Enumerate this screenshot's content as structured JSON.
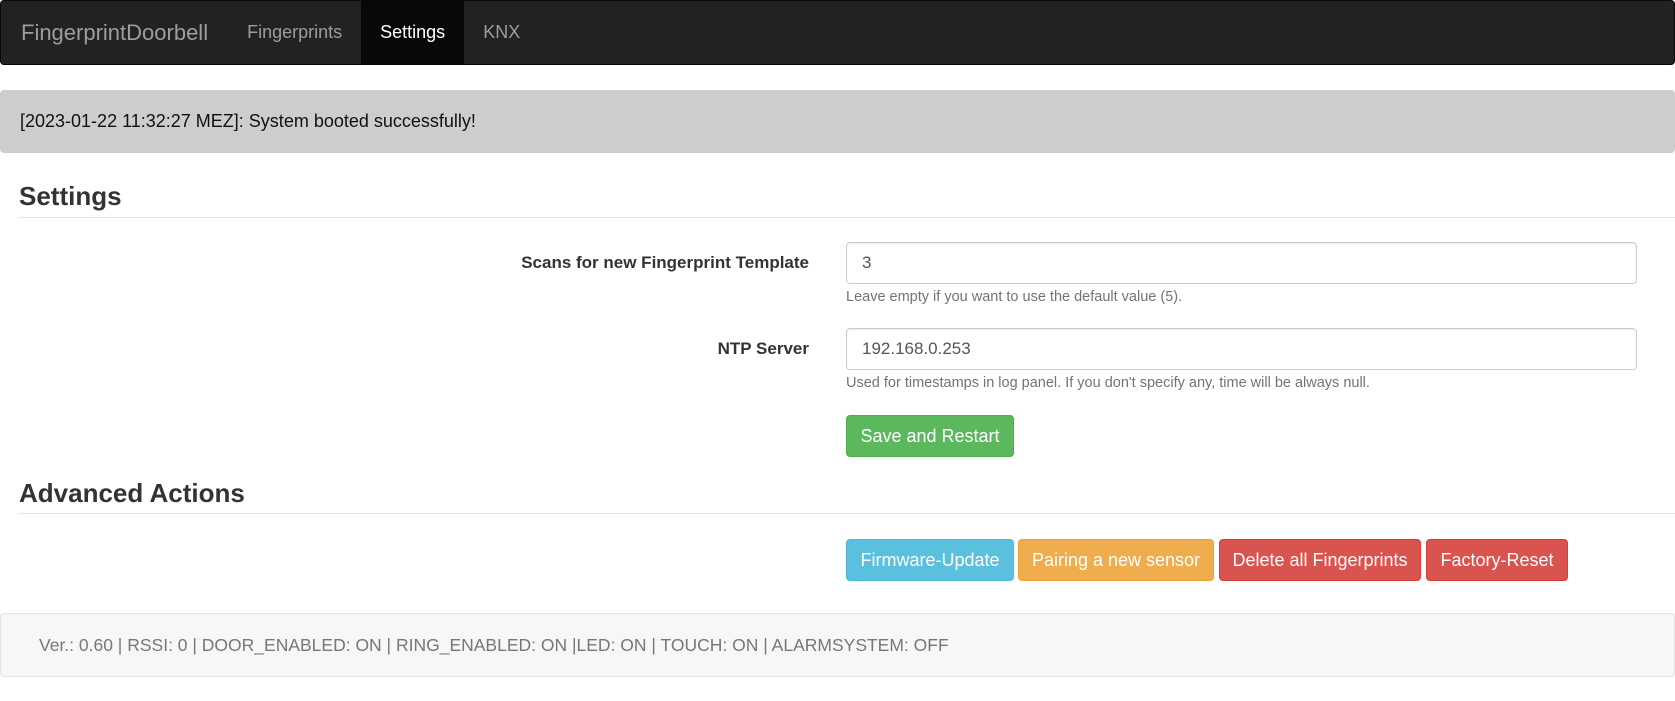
{
  "navbar": {
    "brand": "FingerprintDoorbell",
    "items": [
      {
        "label": "Fingerprints",
        "active": false
      },
      {
        "label": "Settings",
        "active": true
      },
      {
        "label": "KNX",
        "active": false
      }
    ]
  },
  "alert": {
    "message": "[2023-01-22 11:32:27 MEZ]: System booted successfully!"
  },
  "settings": {
    "title": "Settings",
    "scans": {
      "label": "Scans for new Fingerprint Template",
      "value": "3",
      "help": "Leave empty if you want to use the default value (5)."
    },
    "ntp": {
      "label": "NTP Server",
      "value": "192.168.0.253",
      "help": "Used for timestamps in log panel. If you don't specify any, time will be always null."
    },
    "save_label": "Save and Restart"
  },
  "advanced": {
    "title": "Advanced Actions",
    "firmware_label": "Firmware-Update",
    "pairing_label": "Pairing a new sensor",
    "delete_label": "Delete all Fingerprints",
    "factory_label": "Factory-Reset"
  },
  "footer": {
    "status": "Ver.: 0.60 | RSSI: 0 | DOOR_ENABLED: ON | RING_ENABLED: ON |LED: ON | TOUCH: ON | ALARMSYSTEM: OFF"
  },
  "colors": {
    "navbar_bg": "#222222",
    "success": "#5cb85c",
    "info": "#5bc0de",
    "warning": "#f0ad4e",
    "danger": "#d9534f"
  }
}
